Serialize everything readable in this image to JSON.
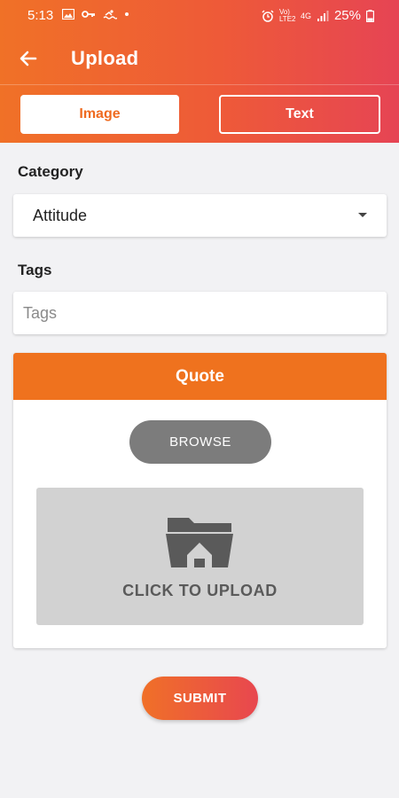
{
  "status_bar": {
    "time": "5:13",
    "left_icons": [
      "image-icon",
      "key-icon",
      "swim-icon",
      "dot-icon"
    ],
    "right_icons": [
      "alarm-icon",
      "volte-icon",
      "4g-icon",
      "signal-icon",
      "battery-icon"
    ],
    "volte_text": "Vo) LTE2",
    "network_text": "4G",
    "battery": "25%"
  },
  "app_bar": {
    "title": "Upload",
    "back_icon": "arrow-left-icon"
  },
  "tabs": [
    {
      "label": "Image",
      "selected": true
    },
    {
      "label": "Text",
      "selected": false
    }
  ],
  "form": {
    "category_label": "Category",
    "category_value": "Attitude",
    "tags_label": "Tags",
    "tags_placeholder": "Tags",
    "tags_value": ""
  },
  "card": {
    "header": "Quote",
    "browse_label": "BROWSE",
    "upload_label": "CLICK TO UPLOAD",
    "upload_icon": "folder-upload-icon"
  },
  "submit_label": "SUBMIT",
  "colors": {
    "accent": "#ef721e",
    "gradient_start": "#f07127",
    "gradient_end": "#e64454",
    "background": "#f2f2f4"
  }
}
